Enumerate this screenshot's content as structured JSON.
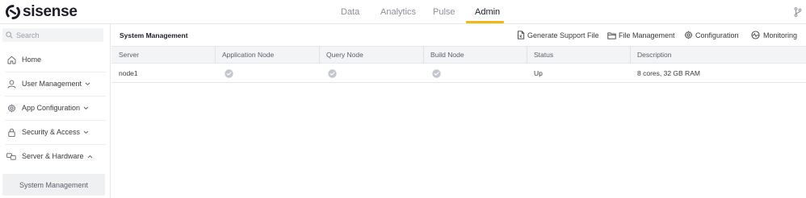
{
  "app": {
    "logo_text": "sisense"
  },
  "nav": {
    "items": [
      {
        "label": "Data",
        "active": false
      },
      {
        "label": "Analytics",
        "active": false
      },
      {
        "label": "Pulse",
        "active": false
      },
      {
        "label": "Admin",
        "active": true
      }
    ],
    "accent_color": "#f2b80e",
    "right_icon": "branch-icon"
  },
  "sidebar": {
    "search_placeholder": "Search",
    "items": [
      {
        "label": "Home",
        "icon": "home-icon",
        "chevron": ""
      },
      {
        "label": "User Management",
        "icon": "user-icon",
        "chevron": "down"
      },
      {
        "label": "App Configuration",
        "icon": "gear-icon",
        "chevron": "down"
      },
      {
        "label": "Security & Access",
        "icon": "lock-icon",
        "chevron": "down"
      },
      {
        "label": "Server & Hardware",
        "icon": "servers-icon",
        "chevron": "up"
      }
    ],
    "sub_item": {
      "label": "System Management",
      "selected": true
    }
  },
  "main": {
    "title": "System Management",
    "actions": [
      {
        "label": "Generate Support File",
        "icon": "file-icon"
      },
      {
        "label": "File Management",
        "icon": "folder-icon"
      },
      {
        "label": "Configuration",
        "icon": "gear-icon"
      },
      {
        "label": "Monitoring",
        "icon": "monitoring-icon"
      }
    ],
    "table": {
      "columns": [
        "Server",
        "Application Node",
        "Query Node",
        "Build Node",
        "Status",
        "Description"
      ],
      "rows": [
        {
          "server": "node1",
          "application_node": true,
          "query_node": true,
          "build_node": true,
          "status": "Up",
          "description": "8 cores, 32 GB RAM"
        }
      ]
    }
  }
}
